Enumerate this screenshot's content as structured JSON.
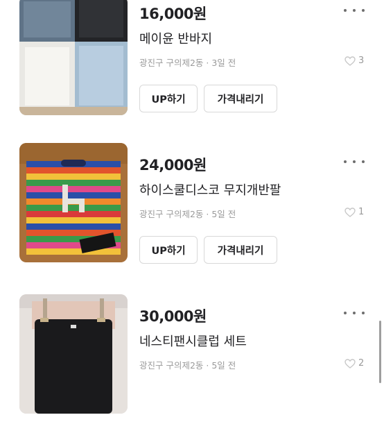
{
  "listings": [
    {
      "price": "16,000원",
      "title": "메이윤 반바지",
      "meta": "광진구 구의제2동 · 3일 전",
      "likes": "3",
      "buttons": {
        "up": "UP하기",
        "price_down": "가격내리기"
      }
    },
    {
      "price": "24,000원",
      "title": "하이스쿨디스코 무지개반팔",
      "meta": "광진구 구의제2동 · 5일 전",
      "likes": "1",
      "buttons": {
        "up": "UP하기",
        "price_down": "가격내리기"
      }
    },
    {
      "price": "30,000원",
      "title": "네스티팬시클럽 세트",
      "meta": "광진구 구의제2동 · 5일 전",
      "likes": "2"
    }
  ],
  "icons": {
    "more": "more-dots-icon",
    "like": "heart-icon"
  }
}
